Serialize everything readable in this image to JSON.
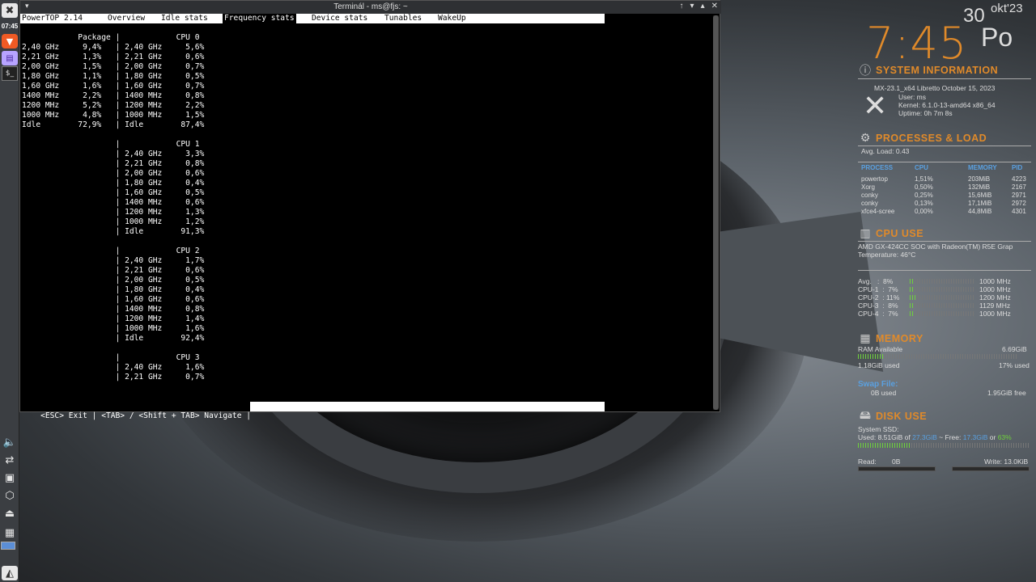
{
  "panel": {
    "clock": "07:45"
  },
  "terminal": {
    "title": "Terminál - ms@fjs: ~",
    "menu_glyph": "▾",
    "controls": {
      "up": "↑",
      "min": "▾",
      "max": "▴",
      "close": "✕"
    },
    "tabs": [
      {
        "label": "PowerTOP 2.14",
        "active": false
      },
      {
        "label": "Overview",
        "active": false
      },
      {
        "label": "Idle stats",
        "active": false
      },
      {
        "label": "Frequency stats",
        "active": true
      },
      {
        "label": "Device stats",
        "active": false
      },
      {
        "label": "Tunables",
        "active": false
      },
      {
        "label": "WakeUp",
        "active": false
      }
    ],
    "lines": [
      "            Package |            CPU 0",
      "2,40 GHz     9,4%   | 2,40 GHz     5,6%",
      "2,21 GHz     1,3%   | 2,21 GHz     0,6%",
      "2,00 GHz     1,5%   | 2,00 GHz     0,7%",
      "1,80 GHz     1,1%   | 1,80 GHz     0,5%",
      "1,60 GHz     1,6%   | 1,60 GHz     0,7%",
      "1400 MHz     2,2%   | 1400 MHz     0,8%",
      "1200 MHz     5,2%   | 1200 MHz     2,2%",
      "1000 MHz     4,8%   | 1000 MHz     1,5%",
      "Idle        72,9%   | Idle        87,4%",
      "",
      "                    |            CPU 1",
      "                    | 2,40 GHz     3,3%",
      "                    | 2,21 GHz     0,8%",
      "                    | 2,00 GHz     0,6%",
      "                    | 1,80 GHz     0,4%",
      "                    | 1,60 GHz     0,5%",
      "                    | 1400 MHz     0,6%",
      "                    | 1200 MHz     1,3%",
      "                    | 1000 MHz     1,2%",
      "                    | Idle        91,3%",
      "",
      "                    |            CPU 2",
      "                    | 2,40 GHz     1,7%",
      "                    | 2,21 GHz     0,6%",
      "                    | 2,00 GHz     0,5%",
      "                    | 1,80 GHz     0,4%",
      "                    | 1,60 GHz     0,6%",
      "                    | 1400 MHz     0,8%",
      "                    | 1200 MHz     1,4%",
      "                    | 1000 MHz     1,6%",
      "                    | Idle        92,4%",
      "",
      "                    |            CPU 3",
      "                    | 2,40 GHz     1,6%",
      "                    | 2,21 GHz     0,7%"
    ],
    "status": "<ESC> Exit | <TAB> / <Shift + TAB> Navigate |"
  },
  "conky": {
    "time": "7:45",
    "day_num": "30",
    "month": "okt'23",
    "day_name": "Po",
    "sysinfo": {
      "heading": "SYSTEM INFORMATION",
      "distro": "MX-23.1_x64 Libretto October 15, 2023",
      "user": "User: ms",
      "kernel": "Kernel: 6.1.0-13-amd64 x86_64",
      "uptime": "Uptime: 0h 7m 8s"
    },
    "processes": {
      "heading": "PROCESSES & LOAD",
      "avg_load": "Avg. Load: 0.43",
      "headers": [
        "PROCESS",
        "CPU",
        "MEMORY",
        "PID"
      ],
      "rows": [
        [
          "powertop",
          "1,51%",
          "203MiB",
          "4223"
        ],
        [
          "Xorg",
          "0,50%",
          "132MiB",
          "2167"
        ],
        [
          "conky",
          "0,25%",
          "15,6MiB",
          "2971"
        ],
        [
          "conky",
          "0,13%",
          "17,1MiB",
          "2972"
        ],
        [
          "xfce4-scree",
          "0,00%",
          "44,8MiB",
          "4301"
        ]
      ]
    },
    "cpu": {
      "heading": "CPU USE",
      "model": "AMD GX-424CC SOC with Radeon(TM) R5E Grap",
      "temp": "Temperature: 46°C",
      "cores": [
        {
          "label": "Avg.   :  8%",
          "freq": "1000 MHz",
          "level": 0.08
        },
        {
          "label": "CPU-1  :  7%",
          "freq": "1000 MHz",
          "level": 0.07
        },
        {
          "label": "CPU-2  : 11%",
          "freq": "1200 MHz",
          "level": 0.11
        },
        {
          "label": "CPU-3  :  8%",
          "freq": "1129 MHz",
          "level": 0.08
        },
        {
          "label": "CPU-4  :  7%",
          "freq": "1000 MHz",
          "level": 0.07
        }
      ]
    },
    "memory": {
      "heading": "MEMORY",
      "ram_label": "RAM Available",
      "ram_value": "6.69GiB",
      "used": "1.18GiB used",
      "pct": "17% used",
      "level": 0.17,
      "swap_label": "Swap File:",
      "swap_used": "0B used",
      "swap_free": "1.95GiB free"
    },
    "disk": {
      "heading": "DISK USE",
      "label": "System SSD:",
      "used_prefix": "Used: 8.51GiB of ",
      "total": "27.3GiB",
      "free_prefix": " ~ Free: ",
      "free": "17.3GiB",
      "or": " or ",
      "pct": "63%",
      "level": 0.31,
      "read_label": "Read:",
      "read_value": "0B",
      "write": "Write: 13.0KiB"
    }
  }
}
